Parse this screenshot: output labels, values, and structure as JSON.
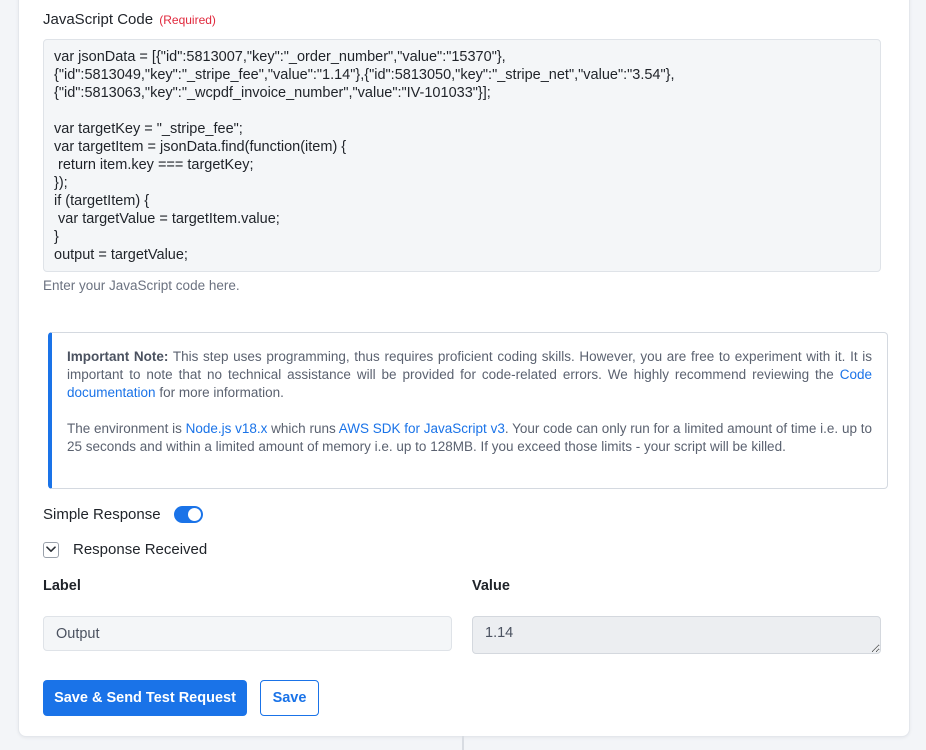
{
  "code_field": {
    "label": "JavaScript Code",
    "required": "(Required)",
    "value": "var jsonData = [{\"id\":5813007,\"key\":\"_order_number\",\"value\":\"15370\"},\n{\"id\":5813049,\"key\":\"_stripe_fee\",\"value\":\"1.14\"},{\"id\":5813050,\"key\":\"_stripe_net\",\"value\":\"3.54\"},\n{\"id\":5813063,\"key\":\"_wcpdf_invoice_number\",\"value\":\"IV-101033\"}];\n\nvar targetKey = \"_stripe_fee\";\nvar targetItem = jsonData.find(function(item) {\n return item.key === targetKey;\n});\nif (targetItem) {\n var targetValue = targetItem.value;\n}\noutput = targetValue;",
    "help": "Enter your JavaScript code here."
  },
  "note": {
    "title": "Important Note:",
    "p1_text": " This step uses programming, thus requires proficient coding skills. However, you are free to experiment with it. It is important to note that no technical assistance will be provided for code-related errors. We highly recommend reviewing the ",
    "p1_link": "Code documentation",
    "p1_end": " for more information.",
    "p2_start": "The environment is ",
    "p2_link1": "Node.js v18.x",
    "p2_mid": " which runs ",
    "p2_link2": "AWS SDK for JavaScript v3",
    "p2_end": ". Your code can only run for a limited amount of time i.e. up to 25 seconds and within a limited amount of memory i.e. up to 128MB. If you exceed those limits - your script will be killed."
  },
  "simple_response": {
    "label": "Simple Response",
    "enabled": true
  },
  "response_received": {
    "label": "Response Received"
  },
  "columns": {
    "label": "Label",
    "value": "Value"
  },
  "row": {
    "label": "Output",
    "value": "1.14"
  },
  "buttons": {
    "send": "Save & Send Test Request",
    "save": "Save"
  },
  "colors": {
    "accent": "#1a73e8",
    "required": "#e0283c"
  }
}
